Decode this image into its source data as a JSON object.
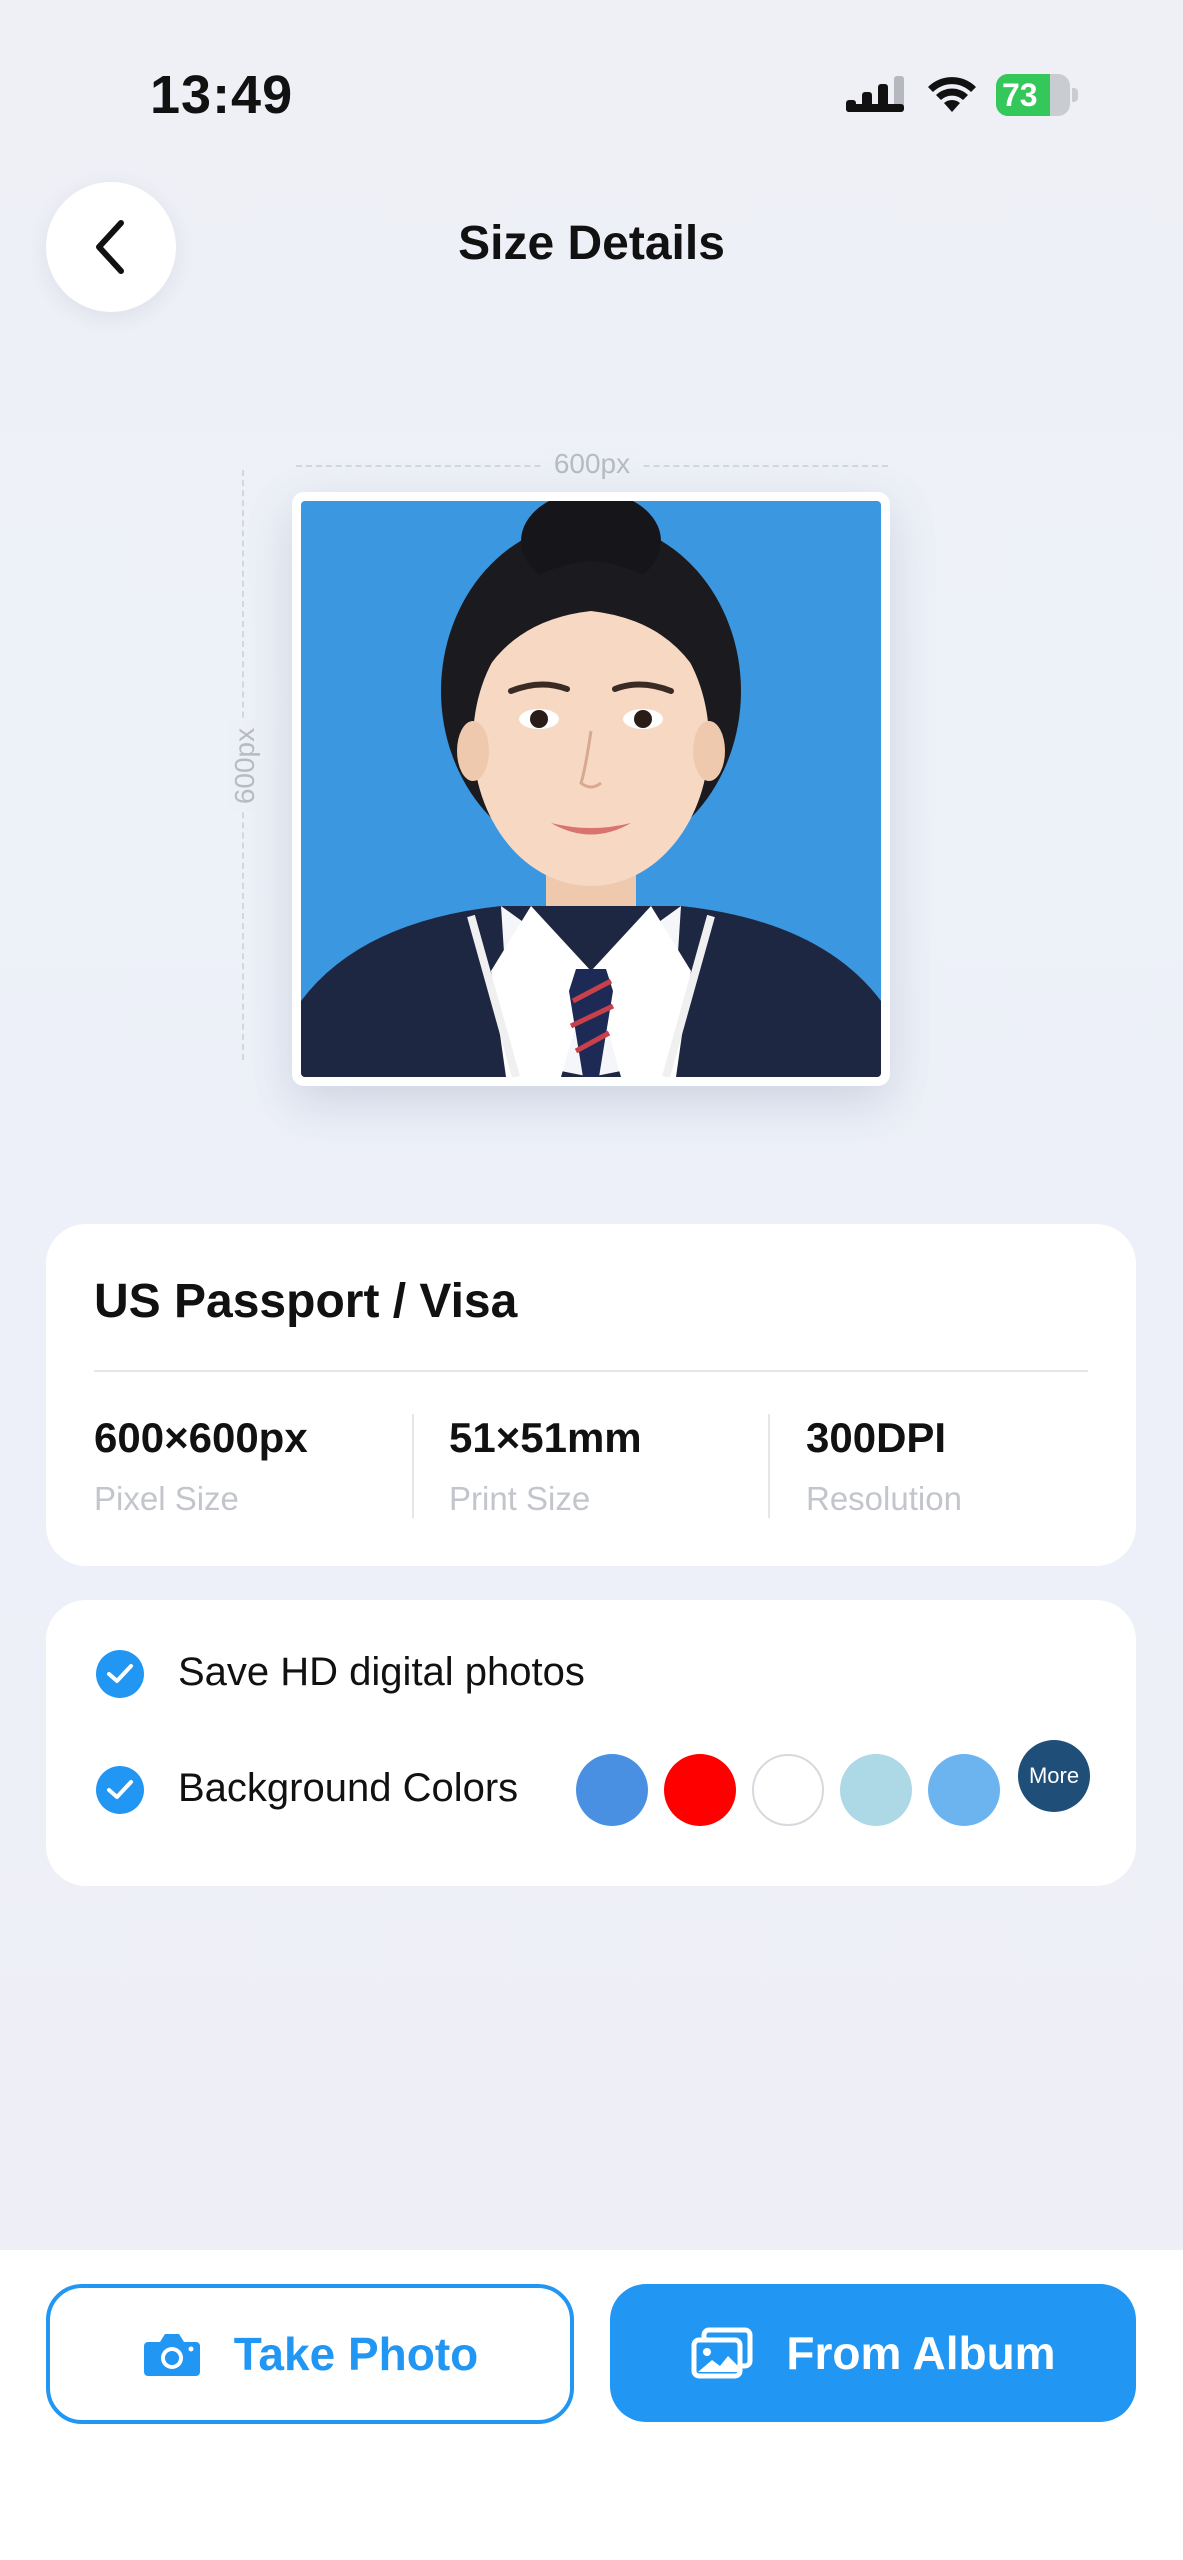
{
  "status_bar": {
    "time": "13:49",
    "battery_level": "73",
    "battery_fraction": 0.73
  },
  "header": {
    "title": "Size Details"
  },
  "preview": {
    "width_label": "600px",
    "height_label": "600px",
    "background_color": "#3b97e0"
  },
  "spec_card": {
    "title": "US Passport / Visa",
    "specs": [
      {
        "value": "600×600px",
        "label": "Pixel Size"
      },
      {
        "value": "51×51mm",
        "label": "Print Size"
      },
      {
        "value": "300DPI",
        "label": "Resolution"
      }
    ]
  },
  "options": {
    "save_hd_label": "Save HD digital photos",
    "save_hd_checked": true,
    "background_label": "Background Colors",
    "background_checked": true,
    "colors": [
      "#4a90e2",
      "#ff0000",
      "#ffffff",
      "#add8e6",
      "#6cb4f0"
    ],
    "more_label": "More",
    "more_color": "#1f4e79"
  },
  "actions": {
    "take_photo_label": "Take Photo",
    "from_album_label": "From Album",
    "accent_color": "#2196f3"
  }
}
